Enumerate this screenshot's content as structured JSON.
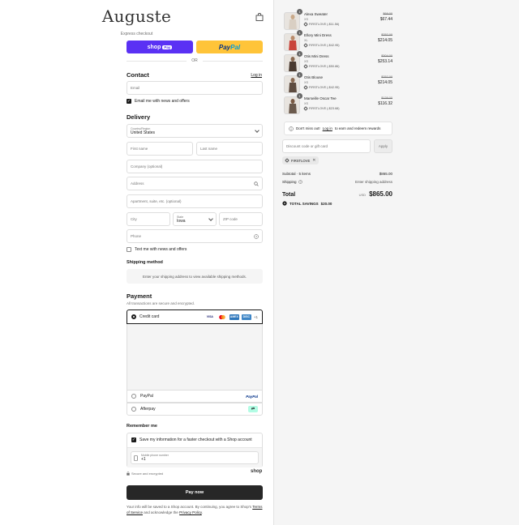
{
  "header": {
    "brand": "Auguste"
  },
  "express": {
    "label": "Express checkout",
    "shop_pay_word": "shop",
    "shop_pay_badge": "Pay",
    "paypal_part1": "Pay",
    "paypal_part2": "Pal",
    "or_label": "OR"
  },
  "contact": {
    "title": "Contact",
    "login_link": "Log in",
    "email_placeholder": "Email",
    "email_news_label": "Email me with news and offers",
    "email_news_checked": true
  },
  "delivery": {
    "title": "Delivery",
    "country_label": "Country/Region",
    "country_value": "United States",
    "first_name": "First name",
    "last_name": "Last name",
    "company": "Company (optional)",
    "address": "Address",
    "apartment": "Apartment, suite, etc. (optional)",
    "city": "City",
    "state_label": "State",
    "state_value": "Iowa",
    "zip": "ZIP code",
    "phone": "Phone",
    "text_news_label": "Text me with news and offers"
  },
  "shipping_method": {
    "title": "Shipping method",
    "message": "Enter your shipping address to view available shipping methods."
  },
  "payment": {
    "title": "Payment",
    "subtitle": "All transactions are secure and encrypted.",
    "credit_card_label": "Credit card",
    "card_logos": [
      "VISA",
      "MC",
      "AMEX",
      "DISC"
    ],
    "more_cards": "+1",
    "paypal_label": "PayPal",
    "paypal_logo": "PayPal",
    "afterpay_label": "Afterpay"
  },
  "remember": {
    "title": "Remember me",
    "save_label": "Save my information for a faster checkout with a Shop account",
    "phone_label": "Mobile phone number",
    "phone_prefix": "+1",
    "secure_label": "Secure and encrypted",
    "shop_logo": "shop"
  },
  "pay_now_label": "Pay now",
  "legal": {
    "text1": "Your info will be saved to a Shop account. By continuing, you agree to Shop's",
    "terms": "Terms of Service",
    "text2": "and acknowledge the",
    "privacy": "Privacy Policy",
    "end": "."
  },
  "cart": {
    "items": [
      {
        "qty": "1",
        "name": "Alexa Sweater",
        "size": "XS",
        "discount": "FIRSTLOVE (-$11.56)",
        "old_price": "$69.00",
        "price": "$67.44",
        "color": "#d9cfc3"
      },
      {
        "qty": "1",
        "name": "Ellory Mini Dress",
        "size": "XL",
        "discount": "FIRSTLOVE (-$42.95)",
        "old_price": "$257.00",
        "price": "$214.05",
        "color": "#c9443b"
      },
      {
        "qty": "1",
        "name": "Otis Mini Dress",
        "size": "XS",
        "discount": "FIRSTLOVE (-$50.86)",
        "old_price": "$304.00",
        "price": "$253.14",
        "color": "#4a3a30"
      },
      {
        "qty": "1",
        "name": "Otis Blouse",
        "size": "XS",
        "discount": "FIRSTLOVE (-$42.95)",
        "old_price": "$257.00",
        "price": "$214.05",
        "color": "#5e4c40"
      },
      {
        "qty": "1",
        "name": "Marseille Oscar Tee",
        "size": "XS",
        "discount": "FIRSTLOVE (-$23.68)",
        "old_price": "$139.00",
        "price": "$116.32",
        "color": "#6b5a4d"
      }
    ],
    "rewards_pre": "Don't miss out!",
    "rewards_link": "Log in",
    "rewards_post": "to earn and redeem rewards",
    "discount_placeholder": "Discount code or gift card",
    "apply_label": "Apply",
    "applied_code": "FIRSTLOVE",
    "subtotal_label": "Subtotal · 5 items",
    "subtotal_value": "$865.00",
    "shipping_label": "Shipping",
    "shipping_value": "Enter shipping address",
    "total_label": "Total",
    "currency": "USD",
    "total_value": "$865.00",
    "savings_label": "TOTAL SAVINGS",
    "savings_value": "$20.00"
  },
  "colors": {
    "shop_purple": "#5a31f4",
    "paypal_yellow": "#ffc439",
    "pay_button": "#272727"
  }
}
